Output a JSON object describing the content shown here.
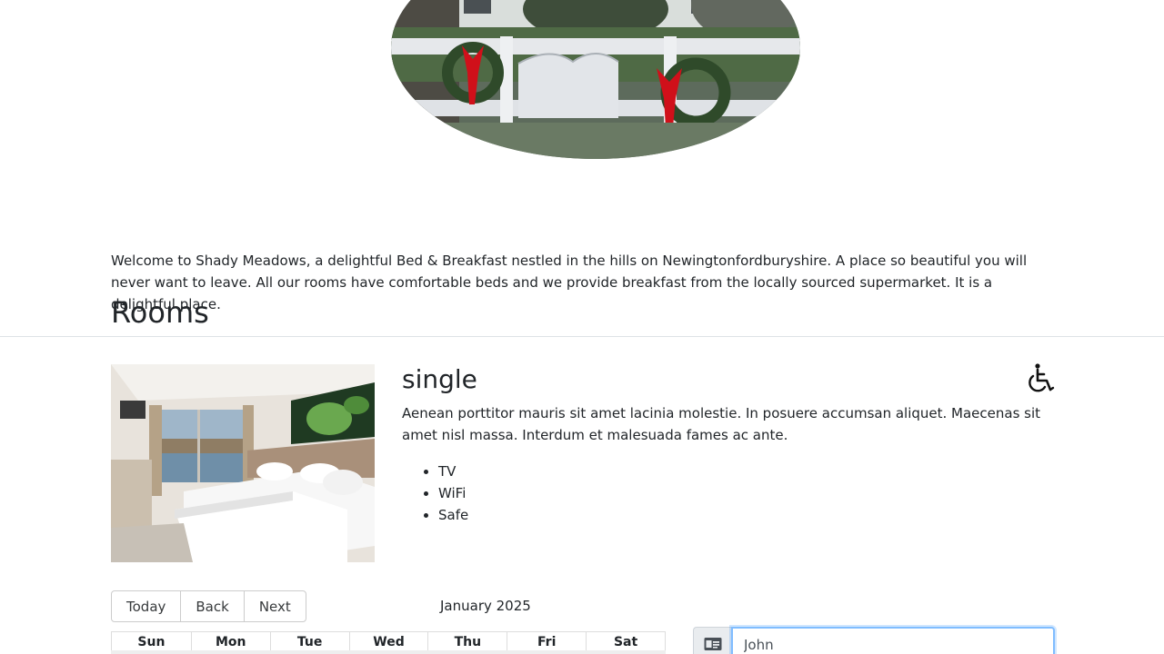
{
  "hero": {
    "image_name": "shady-meadows-house-with-wreaths"
  },
  "intro_text": "Welcome to Shady Meadows, a delightful Bed & Breakfast nestled in the hills on Newingtonfordburyshire. A place so beautiful you will never want to leave. All our rooms have comfortable beds and we provide breakfast from the locally sourced supermarket. It is a delightful place.",
  "rooms_heading": "Rooms",
  "room": {
    "type": "single",
    "description": "Aenean porttitor mauris sit amet lacinia molestie. In posuere accumsan aliquet. Maecenas sit amet nisl massa. Interdum et malesuada fames ac ante.",
    "features": [
      "TV",
      "WiFi",
      "Safe"
    ],
    "accessible_icon": "wheelchair-icon"
  },
  "calendar": {
    "buttons": {
      "today": "Today",
      "back": "Back",
      "next": "Next"
    },
    "label": "January 2025",
    "weekdays": [
      "Sun",
      "Mon",
      "Tue",
      "Wed",
      "Thu",
      "Fri",
      "Sat"
    ]
  },
  "booking_form": {
    "firstname_value": "John",
    "firstname_icon": "id-card-icon"
  },
  "colors": {
    "text": "#212529",
    "focus_border": "#80bdff",
    "wreath_ribbon": "#d0101a"
  }
}
